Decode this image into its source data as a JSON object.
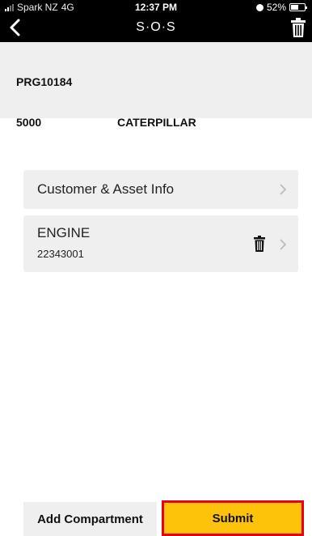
{
  "status_bar": {
    "carrier": "Spark NZ",
    "network": "4G",
    "time": "12:37 PM",
    "battery": "52%"
  },
  "nav": {
    "title": "S·O·S",
    "back_icon": "chevron-left-icon",
    "delete_icon": "trash-icon"
  },
  "header": {
    "code": "PRG10184",
    "number": "5000",
    "make": "CATERPILLAR"
  },
  "items": [
    {
      "label": "Customer & Asset Info"
    },
    {
      "label": "ENGINE",
      "sub": "22343001"
    }
  ],
  "buttons": {
    "add_compartment": "Add Compartment",
    "submit": "Submit"
  },
  "colors": {
    "submit_bg": "#fdc20a",
    "highlight_border": "#e8000f"
  }
}
